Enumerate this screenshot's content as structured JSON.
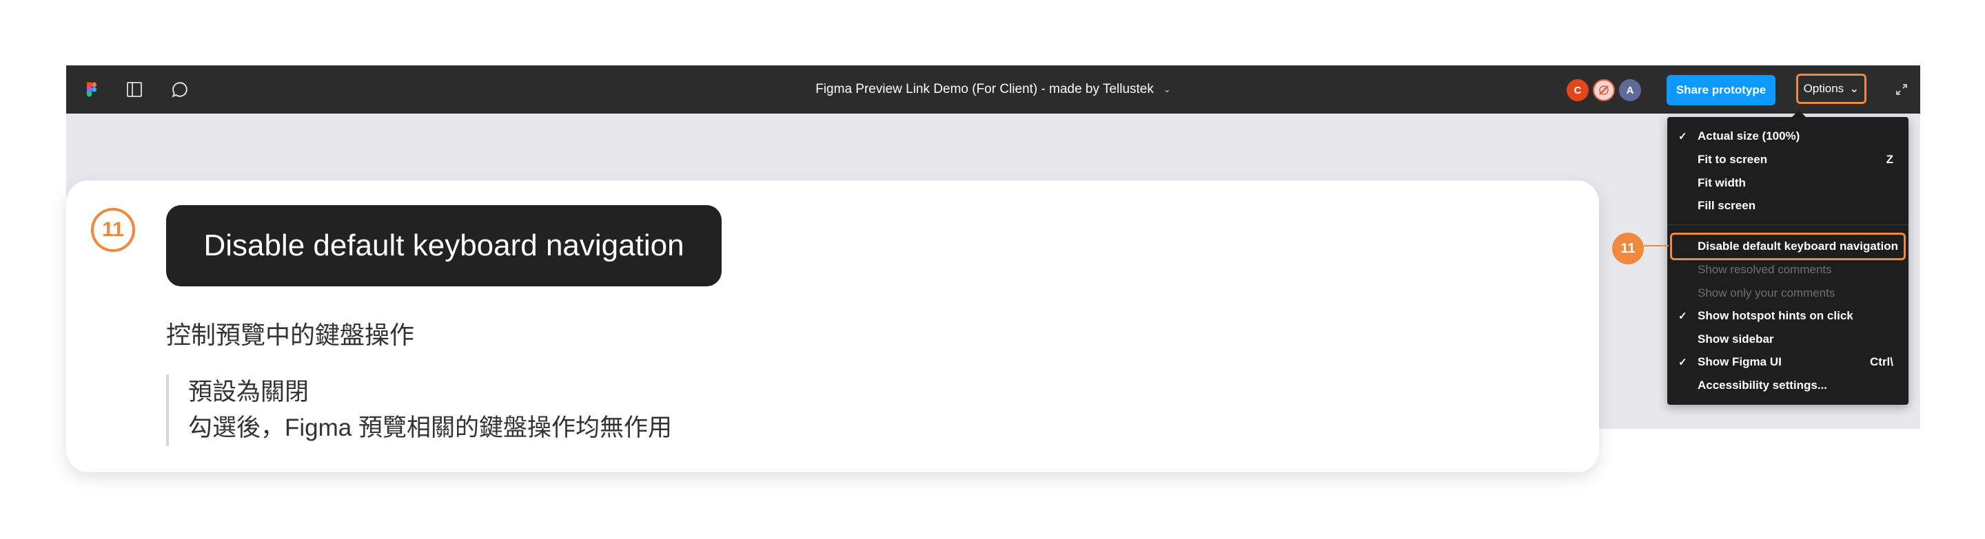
{
  "topbar": {
    "title": "Figma Preview Link Demo (For Client) - made by Tellustek",
    "title_chevron": "⌄",
    "avatars": [
      "C",
      "A"
    ],
    "share_label": "Share prototype",
    "options_label": "Options",
    "options_chevron": "⌄"
  },
  "menu": {
    "items": [
      {
        "label": "Actual size (100%)",
        "checked": "✓",
        "shortcut": ""
      },
      {
        "label": "Fit to screen",
        "checked": "",
        "shortcut": "Z"
      },
      {
        "label": "Fit width",
        "checked": "",
        "shortcut": ""
      },
      {
        "label": "Fill screen",
        "checked": "",
        "shortcut": ""
      },
      {
        "label": "Disable default keyboard navigation",
        "checked": "",
        "shortcut": ""
      },
      {
        "label": "Show resolved comments",
        "checked": "",
        "shortcut": ""
      },
      {
        "label": "Show only your comments",
        "checked": "",
        "shortcut": ""
      },
      {
        "label": "Show hotspot hints on click",
        "checked": "✓",
        "shortcut": ""
      },
      {
        "label": "Show sidebar",
        "checked": "",
        "shortcut": ""
      },
      {
        "label": "Show Figma UI",
        "checked": "✓",
        "shortcut": "Ctrl\\"
      },
      {
        "label": "Accessibility settings...",
        "checked": "",
        "shortcut": ""
      }
    ]
  },
  "callout": {
    "number": "11"
  },
  "card": {
    "step": "11",
    "headline": "Disable default keyboard navigation",
    "subtitle": "控制預覽中的鍵盤操作",
    "notes": [
      "預設為關閉",
      "勾選後，Figma 預覽相關的鍵盤操作均無作用"
    ]
  },
  "colors": {
    "accent": "#f0883e",
    "topbar": "#2c2c2c",
    "share": "#0d99ff",
    "menu_bg": "#1e1e1e",
    "disabled_text": "#6f6f6f"
  },
  "icons": [
    "figma-logo-icon",
    "sidebar-panel-icon",
    "comment-icon",
    "expand-icon",
    "check-icon"
  ]
}
